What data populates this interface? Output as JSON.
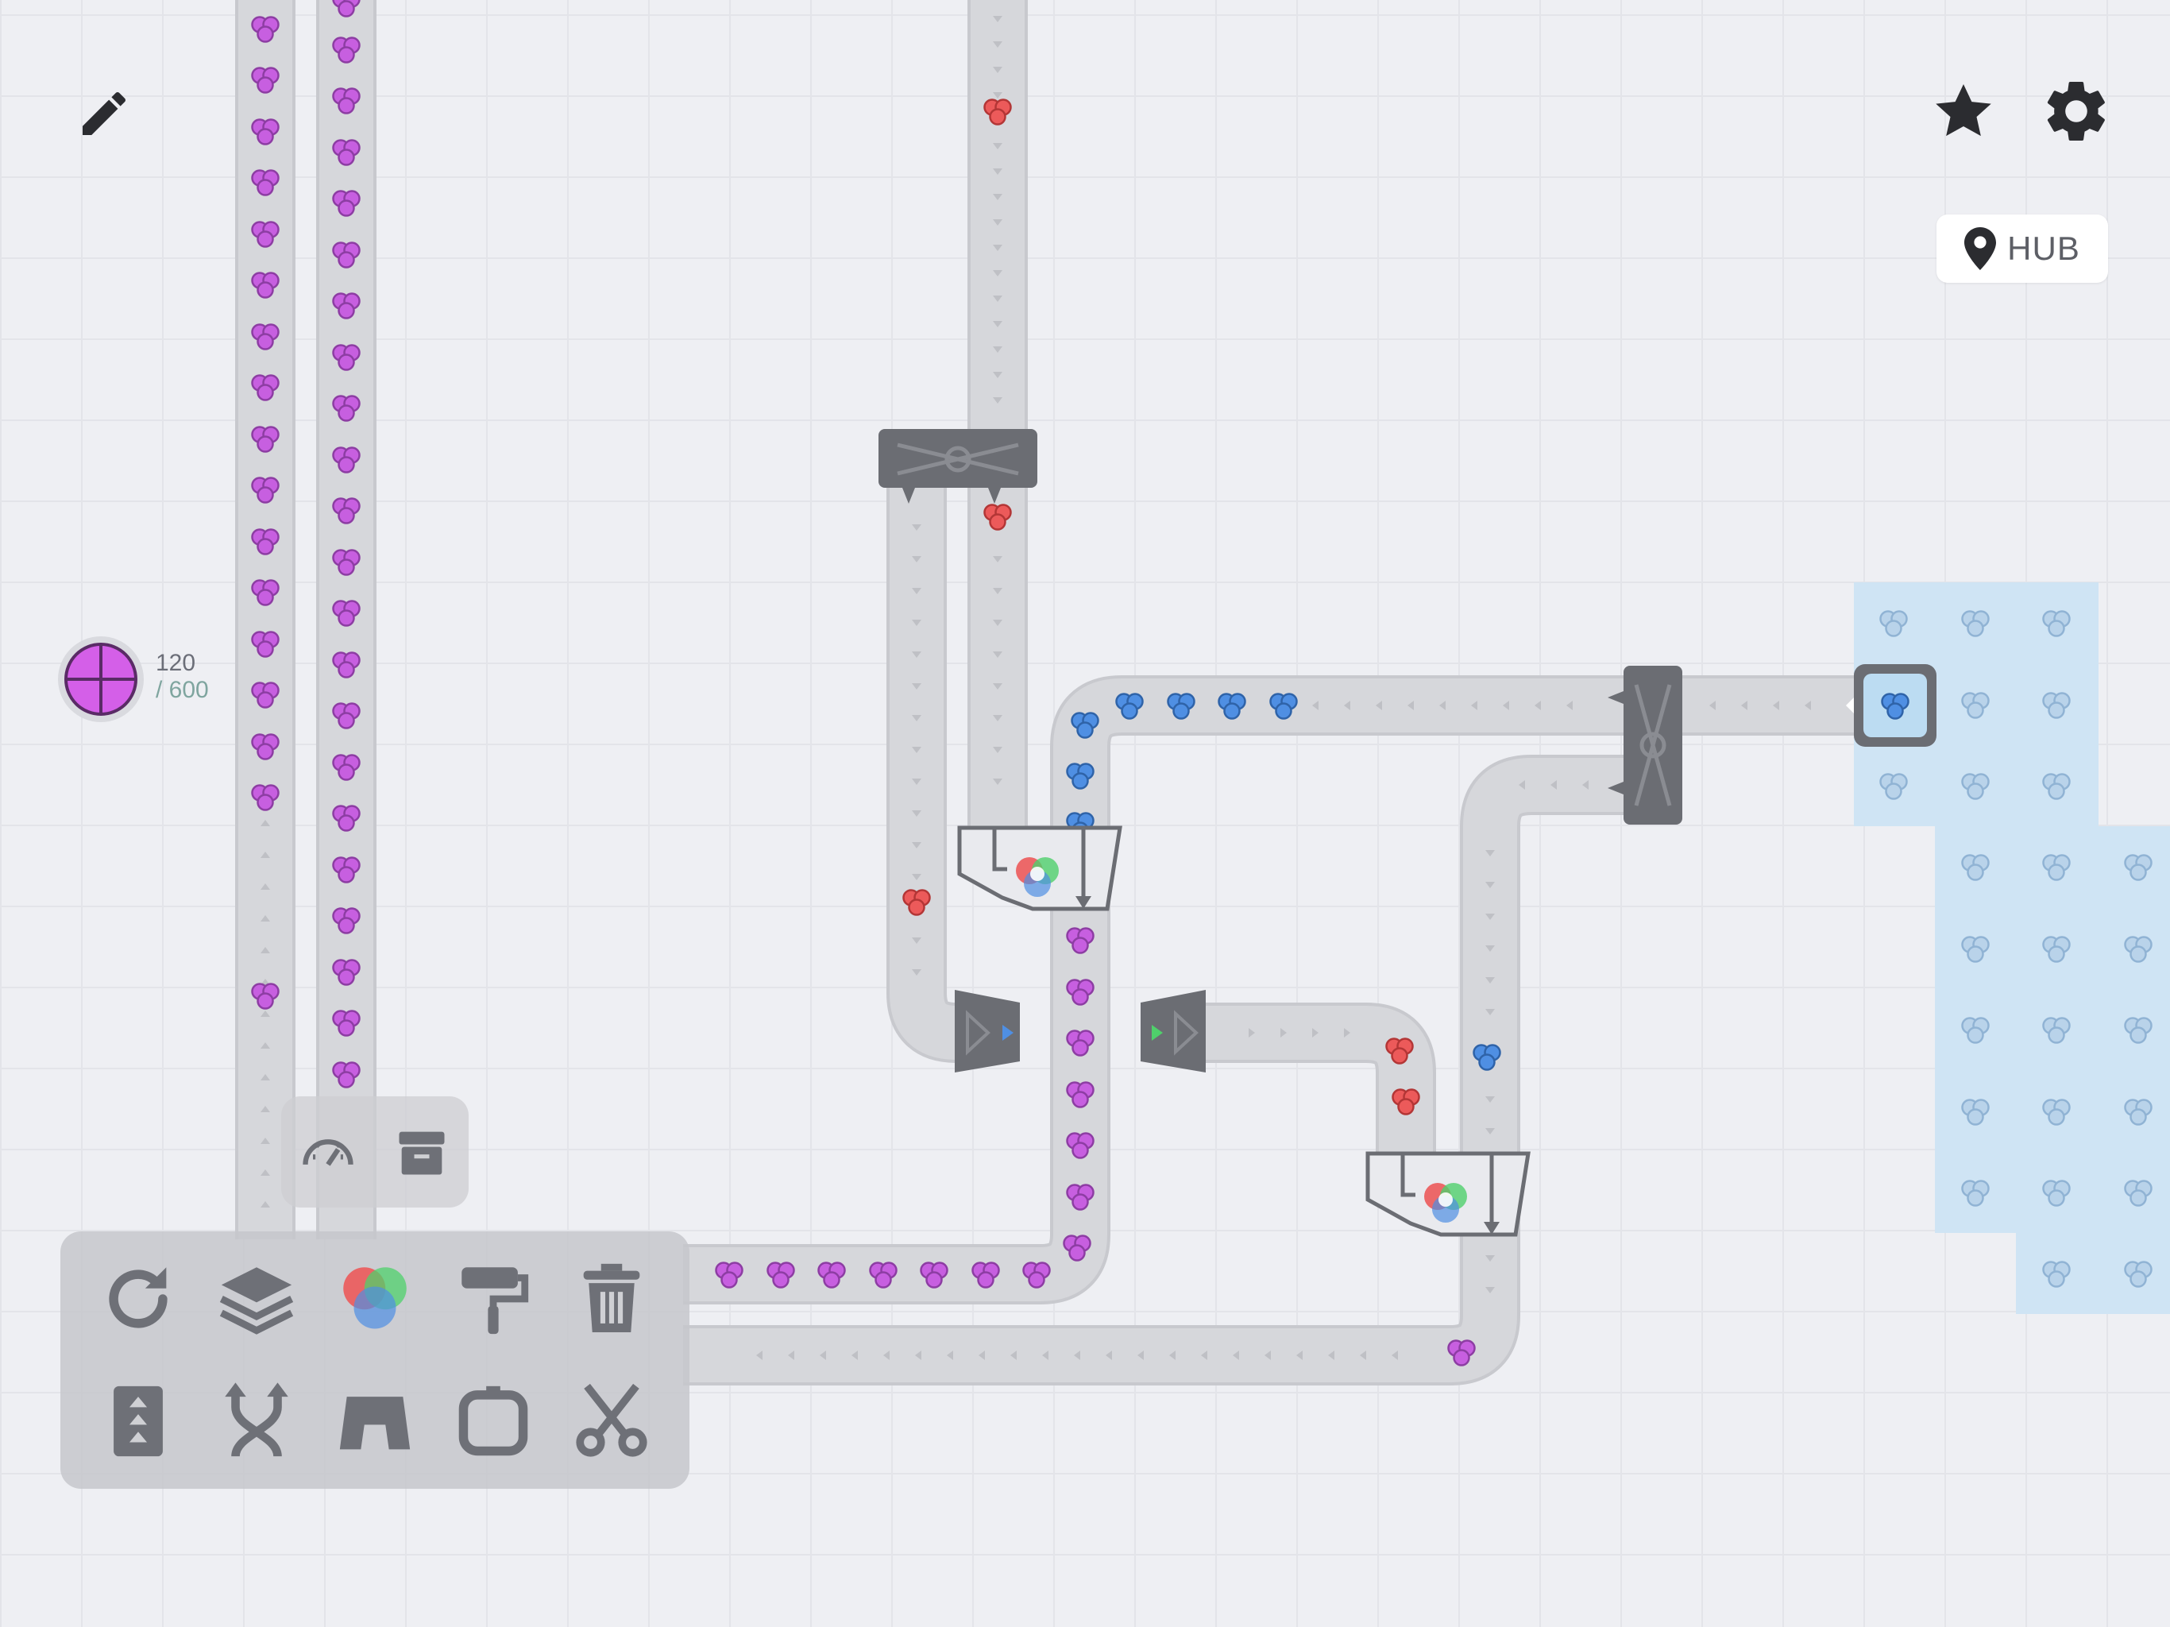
{
  "hub": {
    "label": "HUB"
  },
  "goal": {
    "current": "120",
    "total": "/ 600",
    "shape_color": "#d45fe8"
  },
  "colors": {
    "purple": "#c75fe0",
    "red": "#ec5a5a",
    "blue": "#4f8fe3",
    "belt": "#d6d7db",
    "building": "#6b6d73",
    "hub_area": "#cfe4f4"
  },
  "top_bar": {
    "left": [
      "pencil-icon"
    ],
    "right": [
      "star-icon",
      "gear-icon"
    ]
  },
  "quick_actions": [
    "speedometer-icon",
    "archive-icon"
  ],
  "toolbar": {
    "tools": [
      "rotate-icon",
      "layers-icon",
      "color-mixer-icon",
      "paint-roller-icon",
      "trash-icon",
      "belt-lift-icon",
      "crossing-icon",
      "tunnel-icon",
      "frame-icon",
      "scissors-icon"
    ]
  }
}
